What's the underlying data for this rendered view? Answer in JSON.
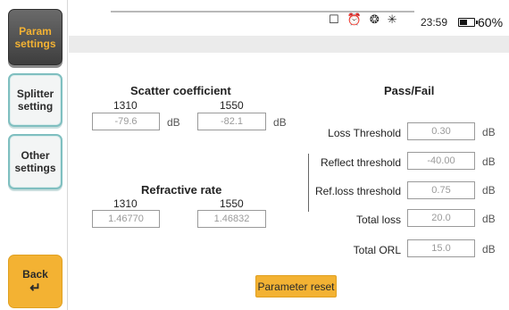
{
  "sidebar": {
    "param_settings": "Param\nsettings",
    "splitter_setting": "Splitter\nsetting",
    "other_settings": "Other\nsettings",
    "back": "Back",
    "back_icon": "↵"
  },
  "status": {
    "time": "23:59",
    "battery": "60%",
    "battery_level": 0.6,
    "icons": [
      "lock-icon",
      "alarm-icon",
      "sun-icon",
      "laser-icon"
    ]
  },
  "scatter": {
    "title": "Scatter coefficient",
    "wl1": "1310",
    "wl2": "1550",
    "value1": "-79.6",
    "value2": "-82.1",
    "unit": "dB"
  },
  "refractive": {
    "title": "Refractive rate",
    "wl1": "1310",
    "wl2": "1550",
    "value1": "1.46770",
    "value2": "1.46832"
  },
  "passfail": {
    "title": "Pass/Fail",
    "unit": "dB",
    "rows": [
      {
        "label": "Loss Threshold",
        "value": "0.30"
      },
      {
        "label": "Reflect threshold",
        "value": "-40.00"
      },
      {
        "label": "Ref.loss threshold",
        "value": "0.75"
      },
      {
        "label": "Total loss",
        "value": "20.0"
      },
      {
        "label": "Total ORL",
        "value": "15.0"
      }
    ]
  },
  "reset_label": "Parameter reset"
}
